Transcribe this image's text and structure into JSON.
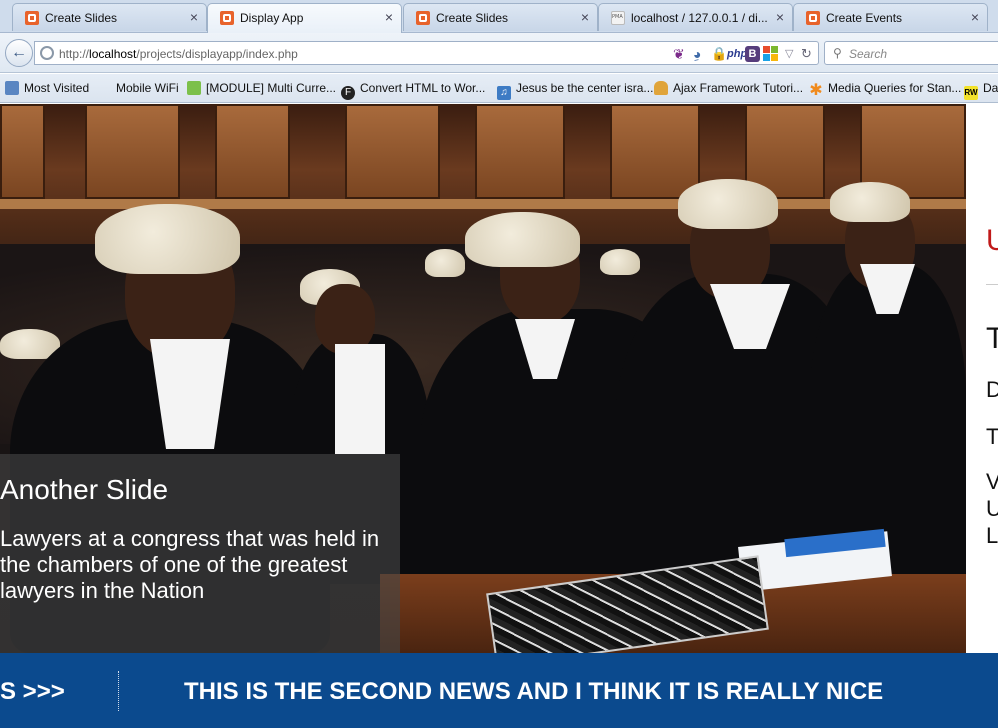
{
  "browser": {
    "tabs": [
      {
        "label": "Create Slides",
        "favicon": "xampp-icon",
        "active": false
      },
      {
        "label": "Display App",
        "favicon": "xampp-icon",
        "active": true
      },
      {
        "label": "Create Slides",
        "favicon": "xampp-icon",
        "active": false
      },
      {
        "label": "localhost / 127.0.0.1 / di...",
        "favicon": "phpmyadmin-icon",
        "active": false
      },
      {
        "label": "Create Events",
        "favicon": "xampp-icon",
        "active": false
      }
    ],
    "close_glyph": "×",
    "url_prefix": "http://",
    "url_host": "localhost",
    "url_path": "/projects/displayapp/index.php",
    "search_placeholder": "Search",
    "ext_php": "php",
    "ext_b": "B",
    "bookmarks": [
      {
        "label": "Most Visited",
        "icon": "bookmark-page-icon"
      },
      {
        "label": "Mobile WiFi",
        "icon": "none"
      },
      {
        "label": "[MODULE] Multi Curre...",
        "icon": "opencart-icon"
      },
      {
        "label": "Convert HTML to Wor...",
        "icon": "f-icon"
      },
      {
        "label": "Jesus be the center isra...",
        "icon": "music-icon"
      },
      {
        "label": "Ajax Framework Tutori...",
        "icon": "folder-icon"
      },
      {
        "label": "Media Queries for Stan...",
        "icon": "asterisk-icon"
      },
      {
        "label": "Da",
        "icon": "rw-icon"
      }
    ]
  },
  "slide": {
    "title": "Another Slide",
    "description": "Lawyers at a congress that was held in the chambers of one of the greatest lawyers in the Nation"
  },
  "right_column": {
    "heading_fragment": "U",
    "lines": [
      "T",
      "D",
      "T",
      "V",
      "U",
      "L"
    ]
  },
  "ticker": {
    "label": "S >>>",
    "text": "THIS IS THE SECOND NEWS AND I THINK IT IS REALLY NICE"
  },
  "colors": {
    "ticker_bg": "#0b4a8e",
    "accent_red": "#c01a1a"
  }
}
